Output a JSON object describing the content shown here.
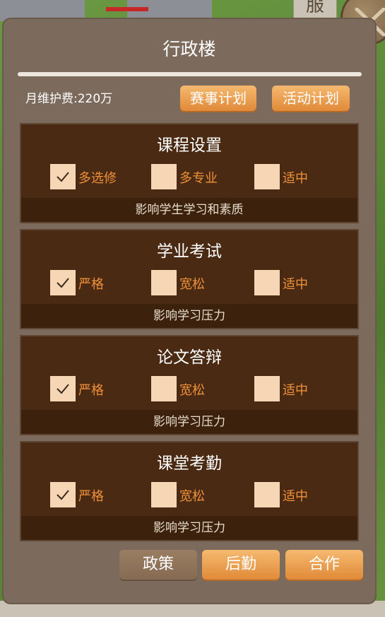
{
  "background": {
    "building_label": "服"
  },
  "panel": {
    "title": "行政楼",
    "monthly_cost": "月维护费:220万",
    "buttons_top": [
      "赛事计划",
      "活动计划"
    ],
    "sections": [
      {
        "title": "课程设置",
        "options": [
          {
            "label": "多选修",
            "checked": true
          },
          {
            "label": "多专业",
            "checked": false
          },
          {
            "label": "适中",
            "checked": false
          }
        ],
        "description": "影响学生学习和素质"
      },
      {
        "title": "学业考试",
        "options": [
          {
            "label": "严格",
            "checked": true
          },
          {
            "label": "宽松",
            "checked": false
          },
          {
            "label": "适中",
            "checked": false
          }
        ],
        "description": "影响学习压力"
      },
      {
        "title": "论文答辩",
        "options": [
          {
            "label": "严格",
            "checked": true
          },
          {
            "label": "宽松",
            "checked": false
          },
          {
            "label": "适中",
            "checked": false
          }
        ],
        "description": "影响学习压力"
      },
      {
        "title": "课堂考勤",
        "options": [
          {
            "label": "严格",
            "checked": true
          },
          {
            "label": "宽松",
            "checked": false
          },
          {
            "label": "适中",
            "checked": false
          }
        ],
        "description": "影响学习压力"
      }
    ],
    "bottom_tabs": [
      {
        "label": "政策",
        "active": true
      },
      {
        "label": "后勤",
        "active": false
      },
      {
        "label": "合作",
        "active": false
      }
    ]
  },
  "colors": {
    "panel_bg": "#7c6b5c",
    "section_bg": "#4a2a12",
    "option_label": "#f0913a",
    "orange_button": "#e08a38"
  }
}
